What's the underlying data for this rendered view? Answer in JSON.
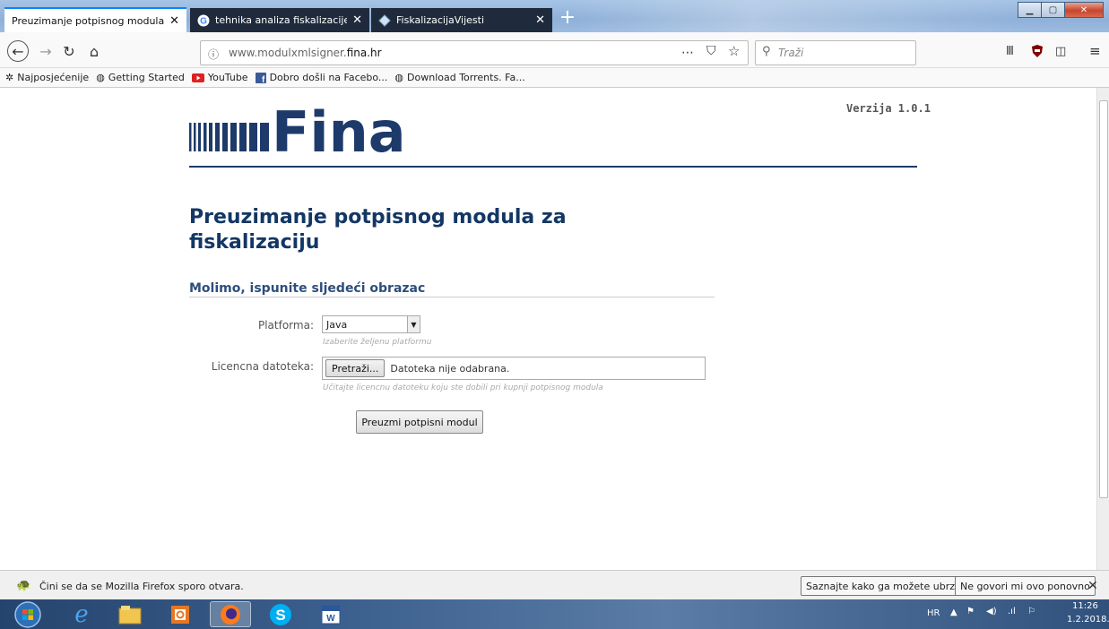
{
  "tabs": [
    {
      "title": "Preuzimanje potpisnog modula za fiskalizaciju",
      "active": true
    },
    {
      "title": "tehnika analiza fiskalizacije - Google",
      "active": false
    },
    {
      "title": "FiskalizacijaVijesti",
      "active": false
    }
  ],
  "nav": {
    "url_prefix": "www.modulxmlsigner.",
    "url_domain": "fina.hr",
    "search_placeholder": "Traži",
    "info_glyph": "ⓘ"
  },
  "bookmarks": [
    {
      "label": "Najposjećenije",
      "icon": "gear-icon"
    },
    {
      "label": "Getting Started",
      "icon": "firefox-icon"
    },
    {
      "label": "YouTube",
      "icon": "youtube-icon"
    },
    {
      "label": "Dobro došli na Facebo...",
      "icon": "facebook-icon"
    },
    {
      "label": "Download Torrents. Fa...",
      "icon": "globe-icon"
    }
  ],
  "page": {
    "logo_text": "Fina",
    "version": "Verzija 1.0.1",
    "title": "Preuzimanje potpisnog modula za fiskalizaciju",
    "subtitle": "Molimo, ispunite sljedeći obrazac",
    "platform_label": "Platforma:",
    "platform_value": "Java",
    "platform_hint": "Izaberite željenu platformu",
    "license_label": "Licencna datoteka:",
    "browse_label": "Pretraži...",
    "file_status": "Datoteka nije odabrana.",
    "license_hint": "Učitajte licencnu datoteku koju ste dobili pri kupnji potpisnog modula",
    "submit_label": "Preuzmi potpisni modul"
  },
  "notification": {
    "message": "Čini se da se Mozilla Firefox sporo otvara.",
    "learn_label": "Saznajte kako ga možete ubrzati",
    "dismiss_label": "Ne govori mi ovo ponovno"
  },
  "taskbar": {
    "language": "HR",
    "time": "11:26",
    "date": "1.2.2018."
  },
  "colors": {
    "accent": "#0a84ff",
    "fina_blue": "#133764",
    "rule": "#1d3a6a"
  }
}
